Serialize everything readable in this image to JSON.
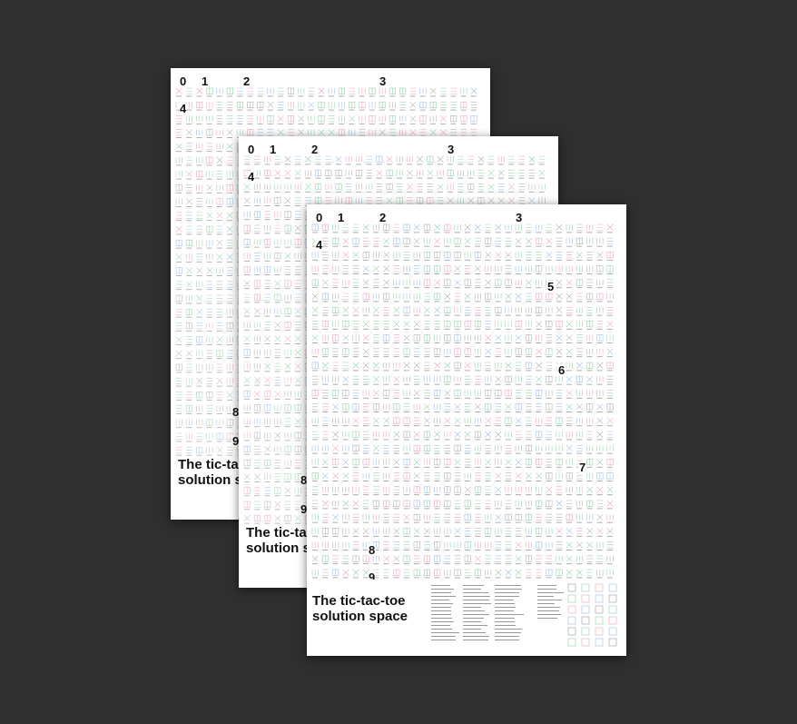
{
  "posters": [
    {
      "id": "back",
      "title_line1": "The tic-tac-toe",
      "title_line2": "solution space",
      "numbers": [
        "0",
        "1",
        "2",
        "3",
        "4",
        "8",
        "9"
      ]
    },
    {
      "id": "mid",
      "title_line1": "The tic-tac-toe",
      "title_line2": "solution space",
      "numbers": [
        "0",
        "1",
        "2",
        "3",
        "4",
        "8",
        "9"
      ]
    },
    {
      "id": "front",
      "title_line1": "The tic-tac-toe",
      "title_line2": "solution space",
      "numbers": [
        "0",
        "1",
        "2",
        "3",
        "4",
        "5",
        "6",
        "7",
        "8",
        "9"
      ]
    }
  ],
  "colors": {
    "background": "#2f2f2f",
    "poster": "#ffffff",
    "x_win": "#3ab36a",
    "o_win": "#e85b8f",
    "draw": "#4a90d9",
    "neutral": "#555555"
  }
}
